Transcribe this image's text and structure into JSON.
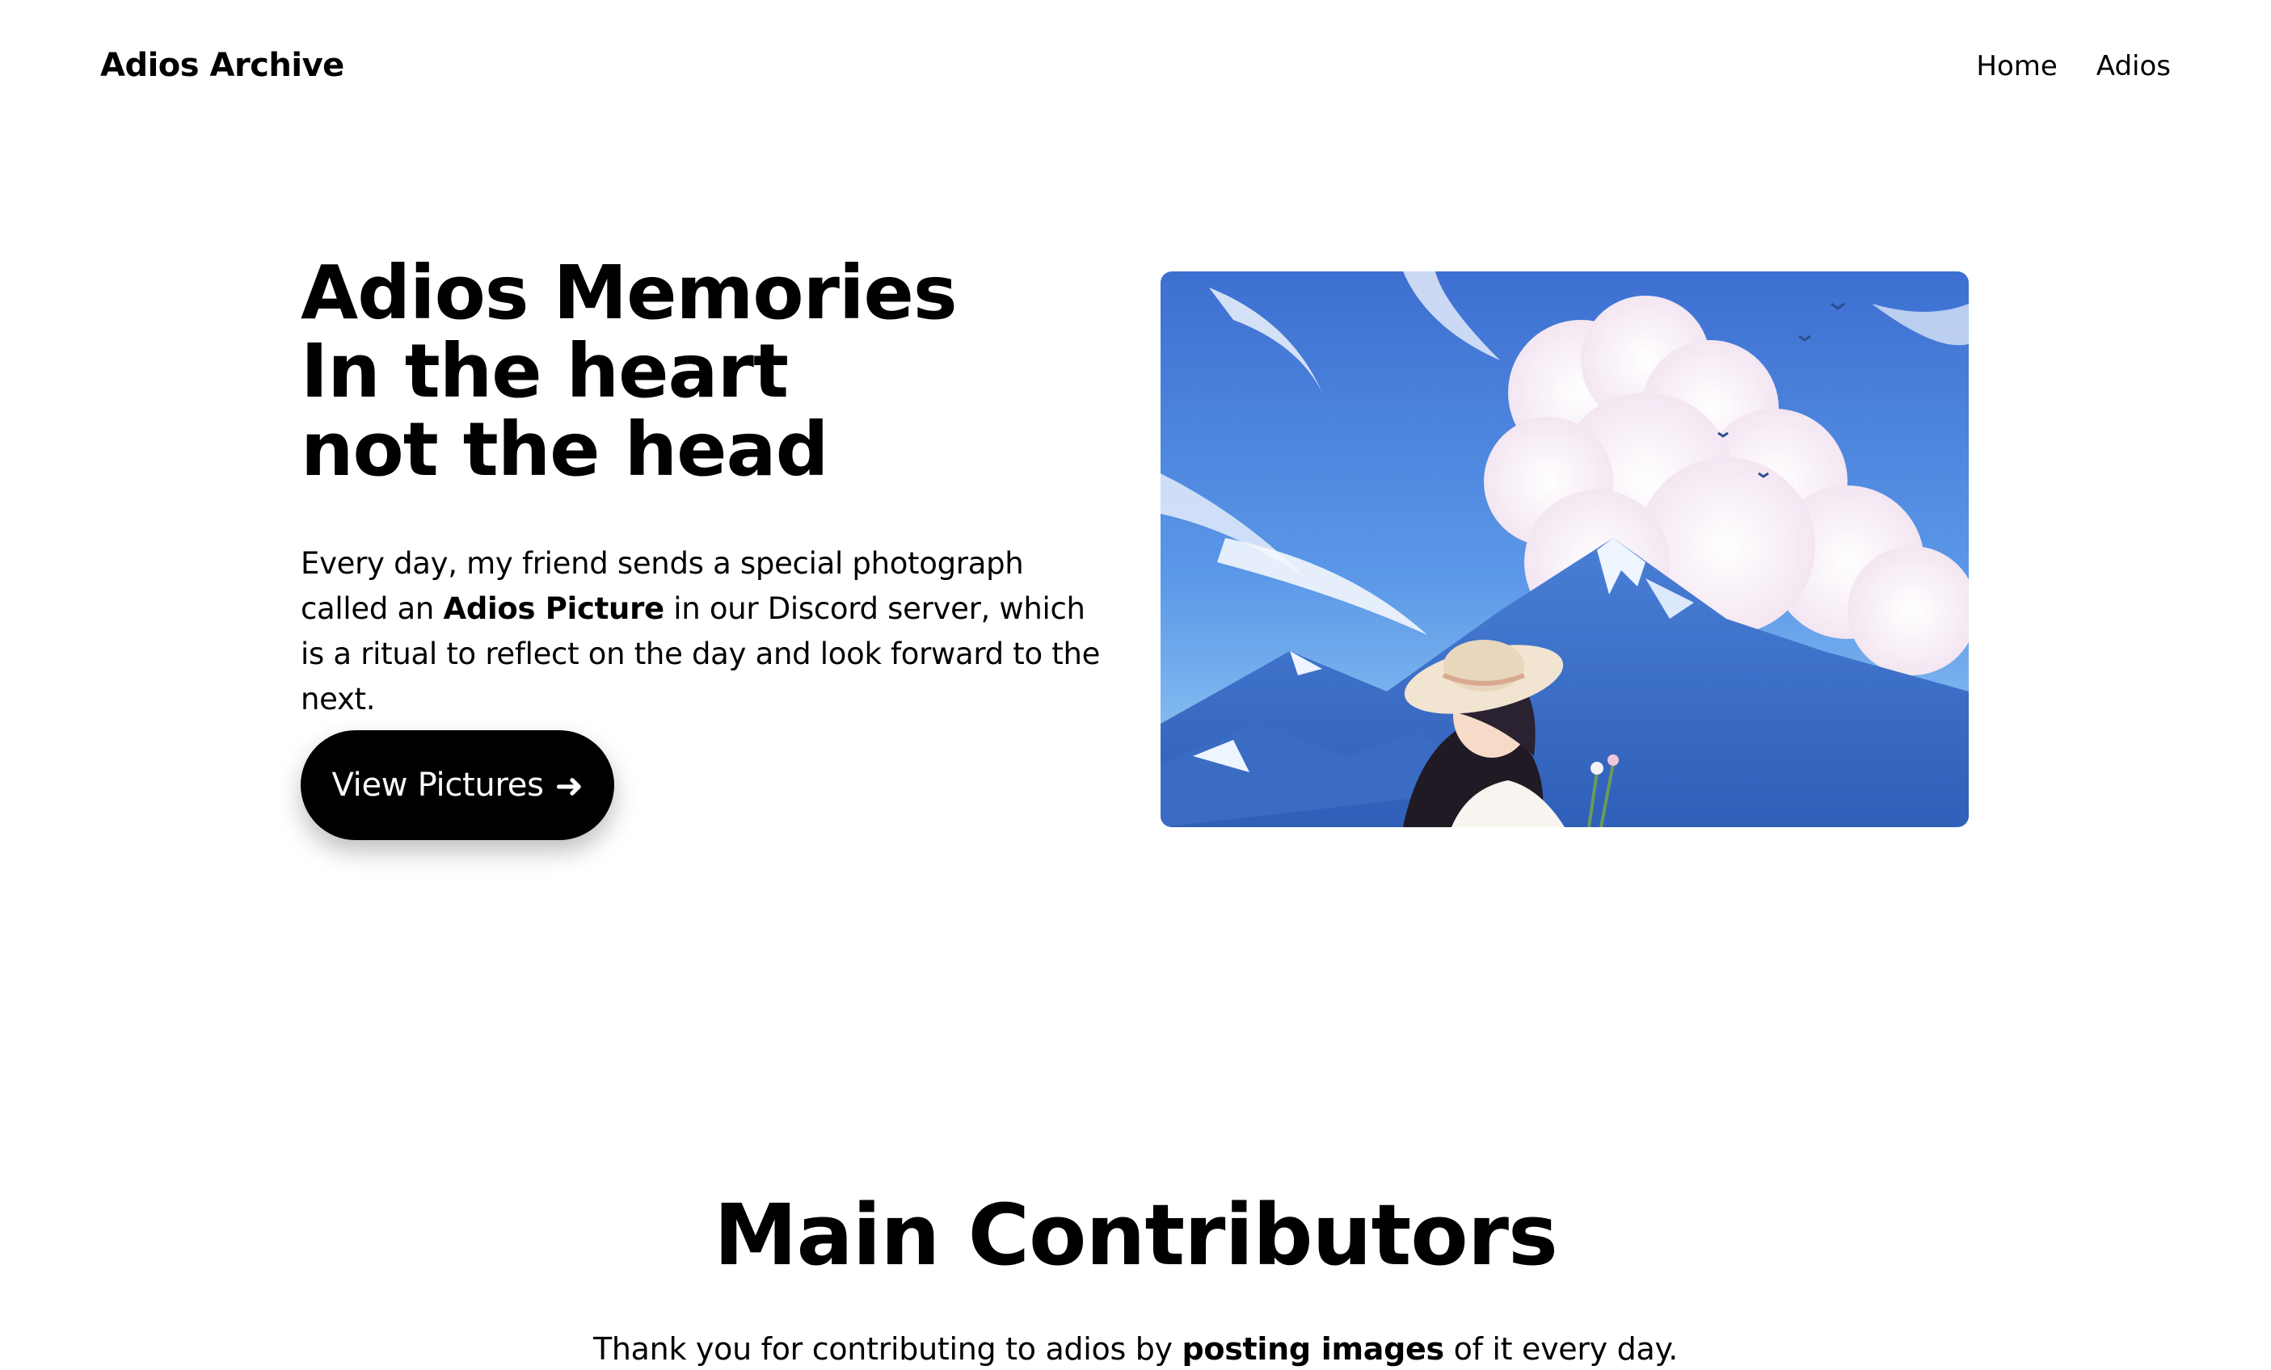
{
  "nav": {
    "brand": "Adios Archive",
    "links": [
      "Home",
      "Adios"
    ]
  },
  "hero": {
    "title_lines": [
      "Adios Memories",
      "In the heart",
      "not the head"
    ],
    "text_part1": "Every day, my friend sends a special photograph called an ",
    "text_bold": "Adios Picture",
    "text_part2": " in our Discord server, which is a ritual to reflect on the day and look forward to the next.",
    "cta_label": "View Pictures",
    "cta_icon": "arrow-right-icon",
    "image_alt": "anime illustration of a girl in a sun hat before snowy mountains and clouds"
  },
  "contributors": {
    "title": "Main Contributors",
    "sub_part1": "Thank you for contributing to adios by ",
    "sub_bold": "posting images",
    "sub_part2": " of it every day."
  },
  "colors": {
    "background": "#ffffff",
    "text": "#000000",
    "button": "#000000",
    "button_text": "#ffffff"
  }
}
